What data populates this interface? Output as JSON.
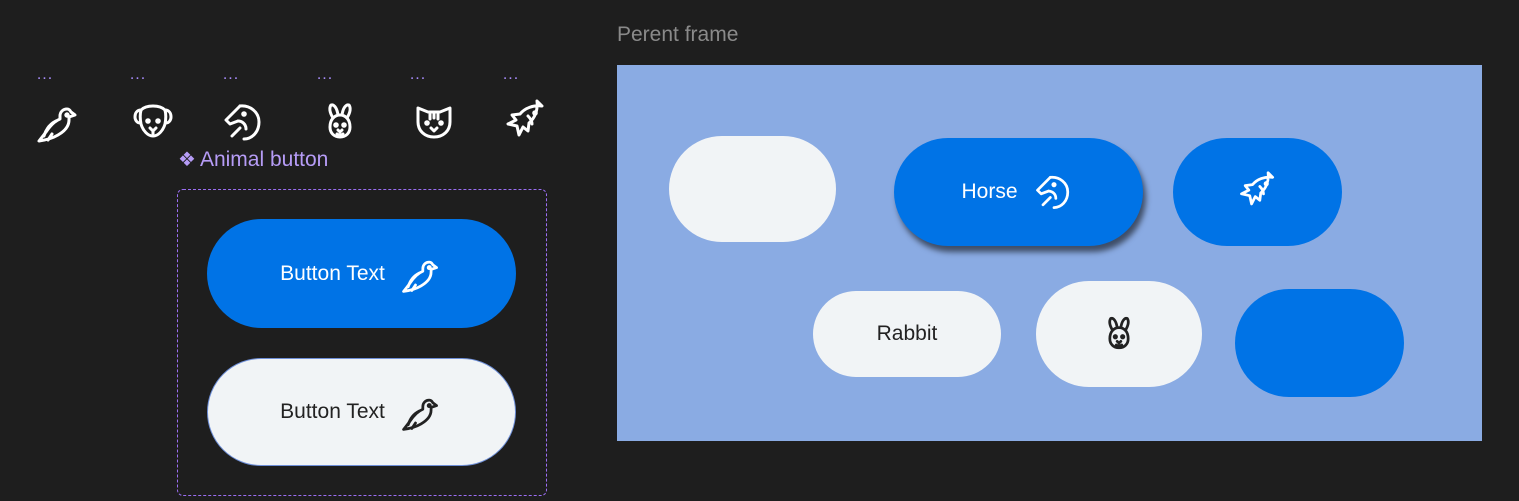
{
  "colors": {
    "canvas": "#1e1e1e",
    "accent_purple": "#a78bfa",
    "button_blue": "#0073e6",
    "button_light": "#f1f4f6",
    "frame_fill": "#8aabe3"
  },
  "icon_row": {
    "dots_label": "...",
    "icons": [
      "bird-icon",
      "dog-icon",
      "horse-icon",
      "rabbit-icon",
      "cat-icon",
      "fish-icon"
    ]
  },
  "component": {
    "label": "Animal button",
    "symbol": "❖",
    "variants": [
      {
        "text": "Button Text",
        "icon": "bird-icon",
        "style": "blue"
      },
      {
        "text": "Button Text",
        "icon": "bird-icon",
        "style": "light"
      }
    ]
  },
  "frame": {
    "title": "Perent frame",
    "buttons": [
      {
        "text": "",
        "icon": "",
        "style": "light"
      },
      {
        "text": "Horse",
        "icon": "horse-icon",
        "style": "blue"
      },
      {
        "text": "",
        "icon": "fish-icon",
        "style": "blue"
      },
      {
        "text": "Rabbit",
        "icon": "",
        "style": "light"
      },
      {
        "text": "",
        "icon": "rabbit-icon",
        "style": "light"
      },
      {
        "text": "",
        "icon": "",
        "style": "blue"
      }
    ]
  }
}
